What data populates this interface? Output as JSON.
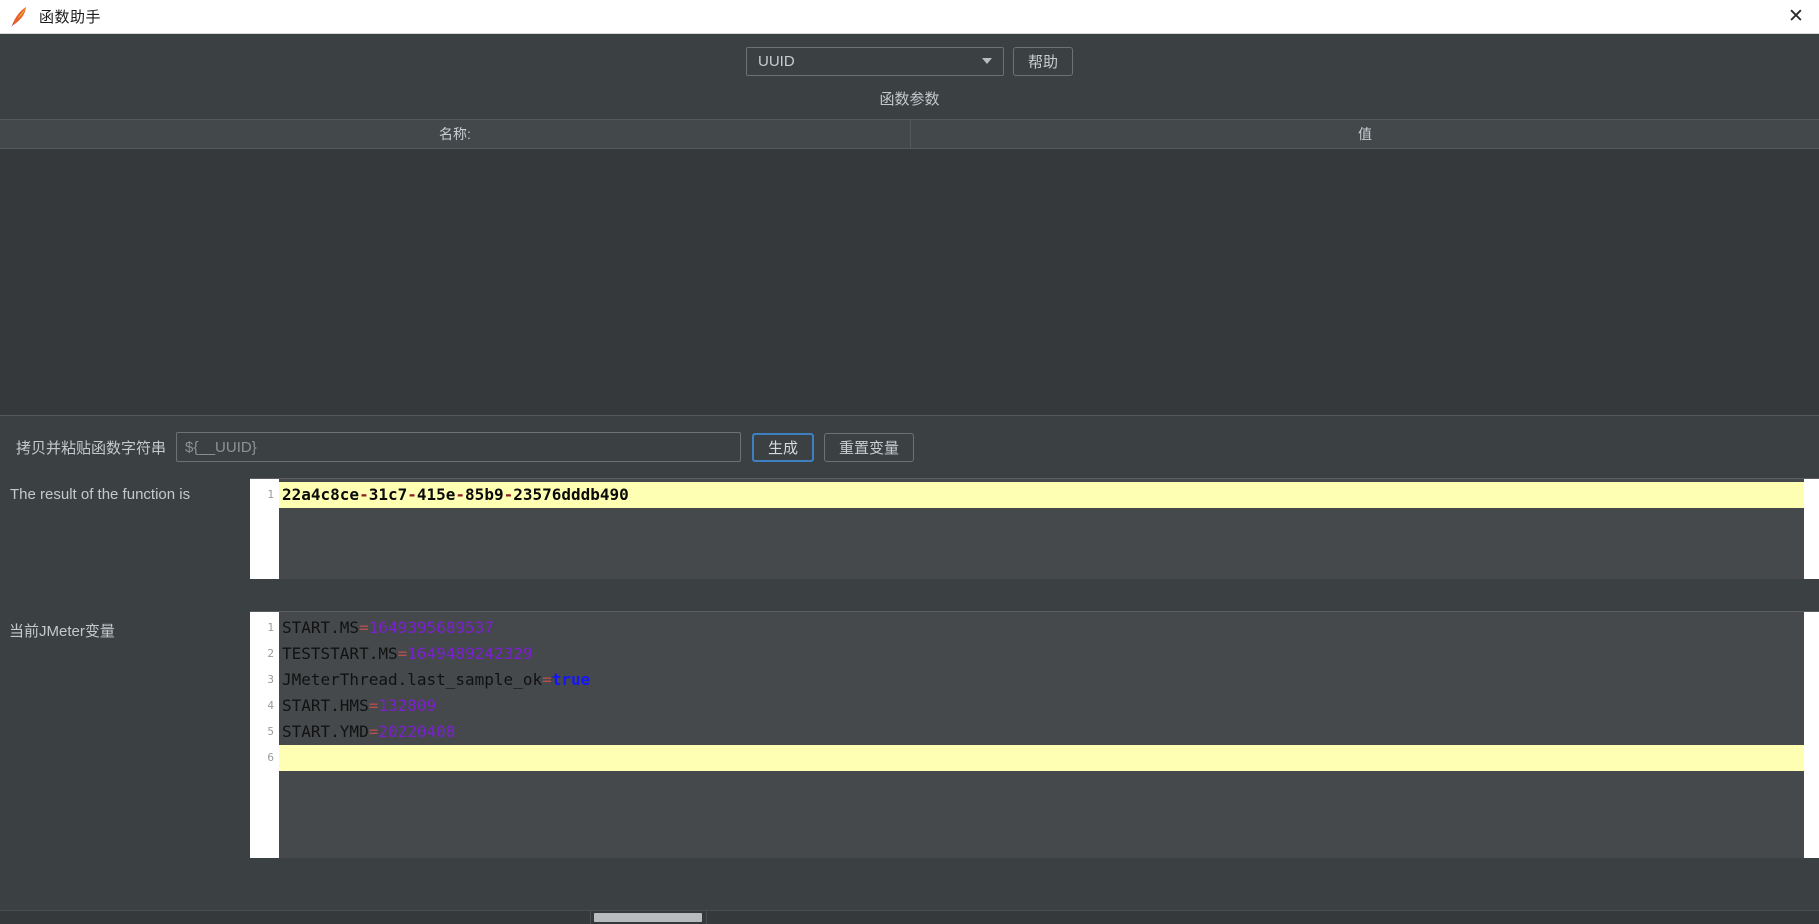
{
  "window": {
    "title": "函数助手",
    "app_icon": "jmeter-feather-icon",
    "close_label": "✕"
  },
  "toolbar": {
    "function_select": {
      "value": "UUID",
      "options": [
        "UUID"
      ]
    },
    "help_label": "帮助"
  },
  "params": {
    "section_title": "函数参数",
    "columns": [
      "名称:",
      "值"
    ],
    "rows": []
  },
  "copy_row": {
    "label": "拷贝并粘贴函数字符串",
    "value": "${__UUID}",
    "placeholder": "${__UUID}",
    "generate_label": "生成",
    "reset_label": "重置变量"
  },
  "result": {
    "label": "The result of the function is",
    "lines": [
      {
        "no": "1",
        "text": "22a4c8ce-31c7-415e-85b9-23576dddb490",
        "highlight": true
      }
    ]
  },
  "variables": {
    "label": "当前JMeter变量",
    "lines": [
      {
        "no": "1",
        "key": "START.MS",
        "eq": "=",
        "value": "1649395689537",
        "type": "num",
        "highlight": false
      },
      {
        "no": "2",
        "key": "TESTSTART.MS",
        "eq": "=",
        "value": "1649489242329",
        "type": "num",
        "highlight": false
      },
      {
        "no": "3",
        "key": "JMeterThread.last_sample_ok",
        "eq": "=",
        "value": "true",
        "type": "bool",
        "highlight": false
      },
      {
        "no": "4",
        "key": "START.HMS",
        "eq": "=",
        "value": "132809",
        "type": "num",
        "highlight": false
      },
      {
        "no": "5",
        "key": "START.YMD",
        "eq": "=",
        "value": "20220408",
        "type": "num",
        "highlight": false
      },
      {
        "no": "6",
        "key": "",
        "eq": "",
        "value": "",
        "type": "empty",
        "highlight": true
      }
    ]
  },
  "colors": {
    "window_bg": "#3b4043",
    "titlebar_bg": "#ffffff",
    "editor_bg": "#45494b",
    "highlight": "#ffffb3",
    "focus_blue": "#3d7fc1",
    "number_violet": "#7c1fd0",
    "bool_blue": "#1414ff",
    "equals_red": "#b4504f"
  }
}
